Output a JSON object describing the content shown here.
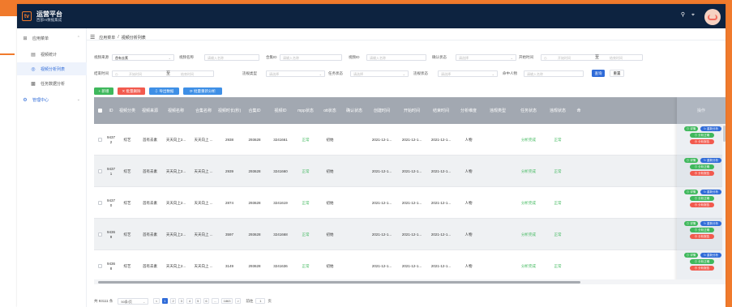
{
  "app": {
    "name": "运营平台",
    "subtitle": "西部AI数据集成",
    "logo": "tv-logo"
  },
  "top_icons": [
    "search-icon",
    "fullscreen-icon"
  ],
  "sidebar": {
    "groups": [
      {
        "label": "应用菜单",
        "icon": "grid-icon",
        "items": [
          {
            "label": "视频统计",
            "icon": "file-icon"
          },
          {
            "label": "视频分析列表",
            "icon": "target-icon"
          },
          {
            "label": "任务数据分析",
            "icon": "bar-chart-icon"
          }
        ]
      },
      {
        "label": "管理中心",
        "icon": "settings-icon"
      }
    ]
  },
  "breadcrumb": [
    "应用菜单",
    "视频分析列表"
  ],
  "filters": {
    "video_source_label": "视频来源",
    "video_source_value": "首有去素",
    "video_name_label": "视频名称",
    "video_name_placeholder": "请输入名称",
    "collection_id_label": "合集ID",
    "collection_id_placeholder": "请输入名称",
    "video_id_label": "视频ID",
    "video_id_placeholder": "请输入名称",
    "confirm_status_label": "确认状态",
    "confirm_status_placeholder": "请选择",
    "start_time_label": "开始时间",
    "start_placeholder": "开始时间",
    "end_placeholder": "结束时间",
    "date_sep": "至",
    "end_time_label": "结束时间",
    "video_type_label": "违规类型",
    "video_type_placeholder": "请选择",
    "task_status_label": "任务状态",
    "task_status_placeholder": "请选择",
    "violation_status_label": "违规状态",
    "violation_status_placeholder": "请选择",
    "person_label": "命中人物",
    "person_placeholder": "请输入名称",
    "query_btn": "查询",
    "reset_btn": "重置"
  },
  "actions": {
    "add": "+ 新增",
    "batch_delete": "批量删除",
    "export": "导出数据",
    "reanalyze": "批量重新分析"
  },
  "table": {
    "columns": [
      "ID",
      "视频分类",
      "视频来源",
      "视频名称",
      "合集名称",
      "视频时长(秒)",
      "合集ID",
      "视频ID",
      "mpp状态",
      "ott状态",
      "确认状态",
      "创建时间",
      "开始时间",
      "结束时间",
      "分析维度",
      "违规类型",
      "任务状态",
      "违规状态",
      "命",
      "操作"
    ],
    "rows": [
      {
        "id": "9437 2",
        "cat": "综艺",
        "src": "首有去素",
        "name": "天天向上2...",
        "coll": "天天向上 ...",
        "dur": "2938",
        "cid": "293628",
        "vid": "3241661",
        "mpp": "正常",
        "ott": "初始",
        "confirm": "",
        "created": "2021-12-1...",
        "start": "2021-12-1...",
        "end": "2021-12-1...",
        "dim": "人物",
        "vtype": "",
        "task": "分析完成",
        "vstatus": "正常"
      },
      {
        "id": "9437 1",
        "cat": "综艺",
        "src": "首有去素",
        "name": "天天向上2...",
        "coll": "天天向上 ...",
        "dur": "2939",
        "cid": "293628",
        "vid": "3241660",
        "mpp": "正常",
        "ott": "初始",
        "confirm": "",
        "created": "2021-12-1...",
        "start": "2021-12-1...",
        "end": "2021-12-1...",
        "dim": "人物",
        "vtype": "",
        "task": "分析完成",
        "vstatus": "正常"
      },
      {
        "id": "9437 0",
        "cat": "综艺",
        "src": "首有去素",
        "name": "天天向上2...",
        "coll": "天天向上 ...",
        "dur": "2874",
        "cid": "293628",
        "vid": "3241619",
        "mpp": "正常",
        "ott": "初始",
        "confirm": "",
        "created": "2021-12-1...",
        "start": "2021-12-1...",
        "end": "2021-12-1...",
        "dim": "人物",
        "vtype": "",
        "task": "分析完成",
        "vstatus": "正常"
      },
      {
        "id": "9436 9",
        "cat": "综艺",
        "src": "首有去素",
        "name": "天天向上2...",
        "coll": "天天向上 ...",
        "dur": "3597",
        "cid": "293628",
        "vid": "3241668",
        "mpp": "正常",
        "ott": "初始",
        "confirm": "",
        "created": "2021-12-1...",
        "start": "2021-12-1...",
        "end": "2021-12-1...",
        "dim": "人物",
        "vtype": "",
        "task": "分析完成",
        "vstatus": "正常"
      },
      {
        "id": "9436 8",
        "cat": "综艺",
        "src": "首有去素",
        "name": "天天向上2...",
        "coll": "天天向上 ...",
        "dur": "3149",
        "cid": "293628",
        "vid": "3241636",
        "mpp": "正常",
        "ott": "初始",
        "confirm": "",
        "created": "2021-12-1...",
        "start": "2021-12-1...",
        "end": "2021-12-1...",
        "dim": "人物",
        "vtype": "",
        "task": "分析完成",
        "vstatus": "正常"
      }
    ],
    "ops": {
      "detail": "详情",
      "reanalyze": "重新分析",
      "confirm": "分析正确",
      "report": "分析报告"
    }
  },
  "pager": {
    "total": "共 93111 条",
    "page_size": "50条/页",
    "pages": [
      "1",
      "2",
      "3",
      "4",
      "5",
      "6",
      "…",
      "1863"
    ],
    "prev": "<",
    "next": ">",
    "goto_label": "前往",
    "goto_value": "1",
    "goto_unit": "页"
  },
  "colors": {
    "brand_orange": "#f07a2c",
    "header_navy": "#0d2340",
    "primary_blue": "#2f6bd8",
    "success_green": "#3fb85c",
    "danger_red": "#f25a4e",
    "table_head": "#a2a8b1"
  }
}
